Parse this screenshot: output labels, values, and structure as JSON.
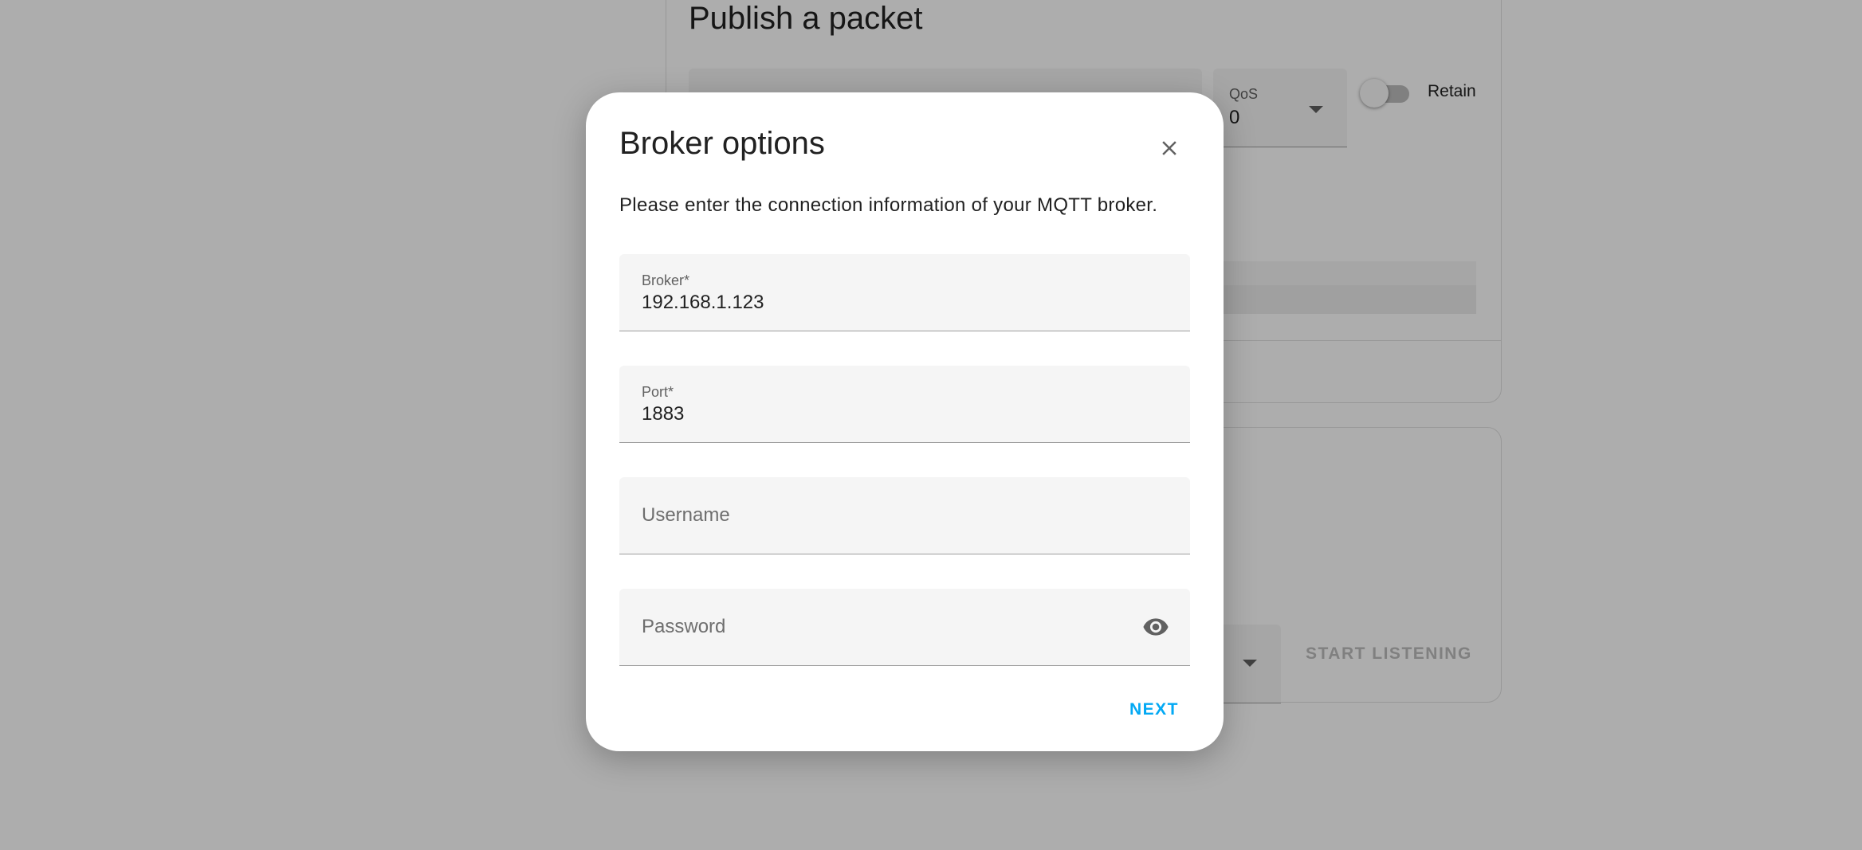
{
  "background": {
    "publish_card": {
      "title": "Publish a packet",
      "qos_label": "QoS",
      "qos_value": "0",
      "retain_label": "Retain",
      "retain_enabled": false
    },
    "subscribe_card": {
      "start_listening_label": "START LISTENING"
    }
  },
  "dialog": {
    "title": "Broker options",
    "description": "Please enter the connection information of your MQTT broker.",
    "fields": {
      "broker": {
        "label": "Broker*",
        "value": "192.168.1.123"
      },
      "port": {
        "label": "Port*",
        "value": "1883"
      },
      "username": {
        "placeholder": "Username",
        "value": ""
      },
      "password": {
        "placeholder": "Password",
        "value": ""
      }
    },
    "next_label": "NEXT"
  },
  "icons": {
    "close": "close-icon",
    "password_visibility": "eye-icon",
    "dropdown": "caret-down-icon"
  },
  "colors": {
    "accent": "#03a9f4",
    "scrim": "rgba(0,0,0,0.32)",
    "field_background": "#f5f5f5"
  }
}
